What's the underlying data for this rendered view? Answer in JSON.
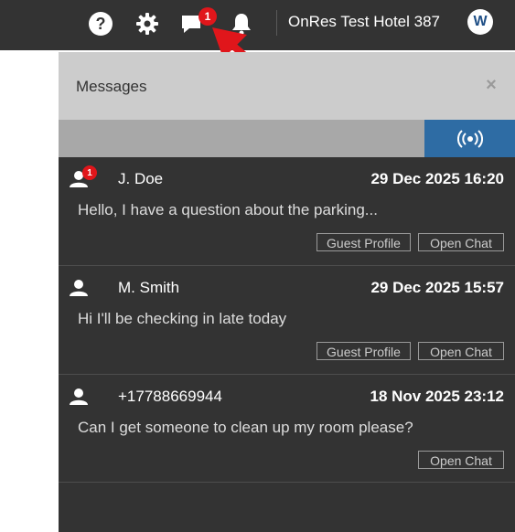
{
  "topbar": {
    "messages_badge": "1",
    "hotel_name": "OnRes Test Hotel 387",
    "avatar_initial": "W"
  },
  "panel": {
    "title": "Messages",
    "close_label": "×"
  },
  "messages": [
    {
      "sender": "J. Doe",
      "time": "29 Dec 2025 16:20",
      "text": "Hello, I have a question about the parking...",
      "unread": "1",
      "guest_profile_label": "Guest Profile",
      "open_chat_label": "Open Chat"
    },
    {
      "sender": "M. Smith",
      "time": "29 Dec 2025 15:57",
      "text": "Hi I'll be checking in late today",
      "guest_profile_label": "Guest Profile",
      "open_chat_label": "Open Chat"
    },
    {
      "sender": "+17788669944",
      "time": "18 Nov 2025 23:12",
      "text": "Can I get someone to clean up my room please?",
      "open_chat_label": "Open Chat"
    }
  ],
  "colors": {
    "topbar": "#333333",
    "panel_bg": "#333333",
    "header_bg": "#cccccc",
    "filter_bar": "#a8a8a8",
    "live_button": "#2e6ca4",
    "badge": "#e0161b",
    "annotation_arrow": "#e0161b"
  },
  "icons": [
    "question-icon",
    "gear-icon",
    "chat-icon",
    "bell-icon",
    "broadcast-icon",
    "user-icon",
    "arrow-annotation"
  ]
}
